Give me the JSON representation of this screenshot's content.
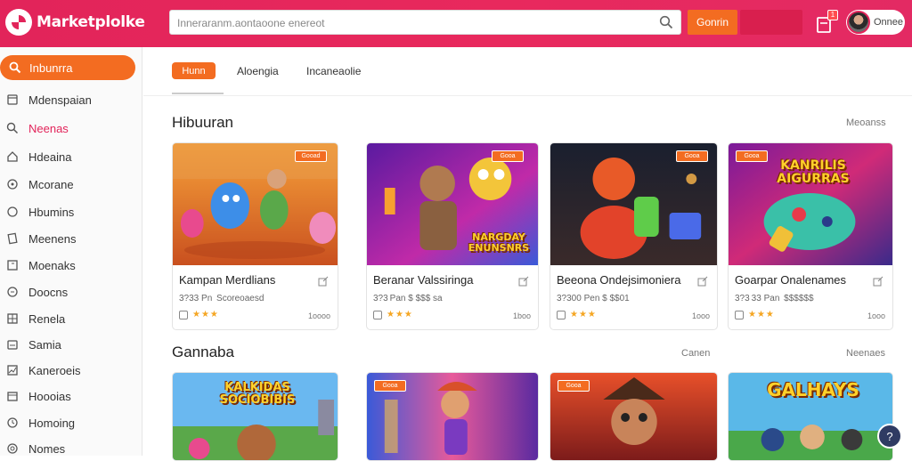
{
  "header": {
    "logo_text": "Marketplolke",
    "search_placeholder": "Inneraranm.aontaoone enereot",
    "search_button": "Gonrin",
    "cart_badge": "1",
    "user_name": "Onnee"
  },
  "sidebar": {
    "active": "Inbunrra",
    "items": [
      "Mdenspaian",
      "Neenas",
      "Hdeaina",
      "Mcorane",
      "Hbumins",
      "Meenens",
      "Moenaks",
      "Doocns",
      "Renela",
      "Samia",
      "Kaneroeis",
      "Hoooias",
      "Homoing",
      "Nomes"
    ]
  },
  "tabs": {
    "active": "Hunn",
    "items": [
      "Aloengia",
      "Incaneaolie"
    ]
  },
  "sections": [
    {
      "title": "Hibuuran",
      "link": "Meoanss"
    },
    {
      "title": "Gannaba",
      "mid_link": "Canen",
      "link": "Neenaes"
    }
  ],
  "cards": [
    {
      "title": "Kampan Merdlians",
      "price": "3?33 Pn  Scoreoaesd",
      "rating": "★★★",
      "count": "1oooo",
      "badge": "Gooad"
    },
    {
      "title": "Beranar Valssiringa",
      "price": "3?3 Pan $ $$$ sa",
      "rating": "★★★",
      "count": "1boo",
      "badge": "Gooa"
    },
    {
      "title": "Beeona Ondejsimoniera",
      "price": "3?300 Pen $ $$01",
      "rating": "★★★",
      "count": "1ooo",
      "badge": "Gooa"
    },
    {
      "title": "Goarpar Onalenames",
      "price": "3?3 33 Pan  $$$$$$",
      "rating": "★★★",
      "count": "1ooo",
      "badge": "Gooa"
    }
  ],
  "art_titles": [
    "NARGDAY ENUNSNRS",
    "KANRILIS AIGURRAS",
    "KALKIDAS SOCIOBIBIS",
    "GALHAYS"
  ],
  "help_icon": "?",
  "colors": {
    "brand": "#e2245a",
    "accent": "#f36c21",
    "star": "#f5a623"
  }
}
